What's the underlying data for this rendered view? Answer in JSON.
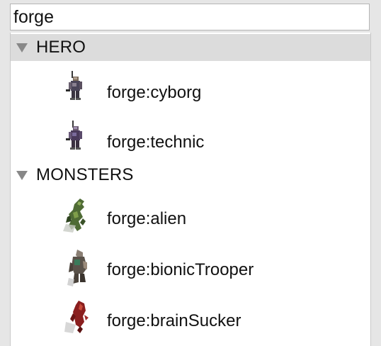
{
  "search": {
    "value": "forge",
    "icon": "text-input"
  },
  "groups": [
    {
      "label": "HERO",
      "expanded": true,
      "selected": true,
      "items": [
        {
          "label": "forge:cyborg",
          "icon": "cyborg-sprite-icon"
        },
        {
          "label": "forge:technic",
          "icon": "technic-sprite-icon"
        }
      ]
    },
    {
      "label": "MONSTERS",
      "expanded": true,
      "selected": false,
      "items": [
        {
          "label": "forge:alien",
          "icon": "alien-sprite-icon"
        },
        {
          "label": "forge:bionicTrooper",
          "icon": "bionic-trooper-sprite-icon"
        },
        {
          "label": "forge:brainSucker",
          "icon": "brain-sucker-sprite-icon"
        }
      ]
    }
  ],
  "colors": {
    "panel_bg": "#e6e6e6",
    "list_bg": "#ffffff",
    "selected_header_bg": "#dcdcdc",
    "disclosure": "#888888",
    "text": "#111111"
  }
}
